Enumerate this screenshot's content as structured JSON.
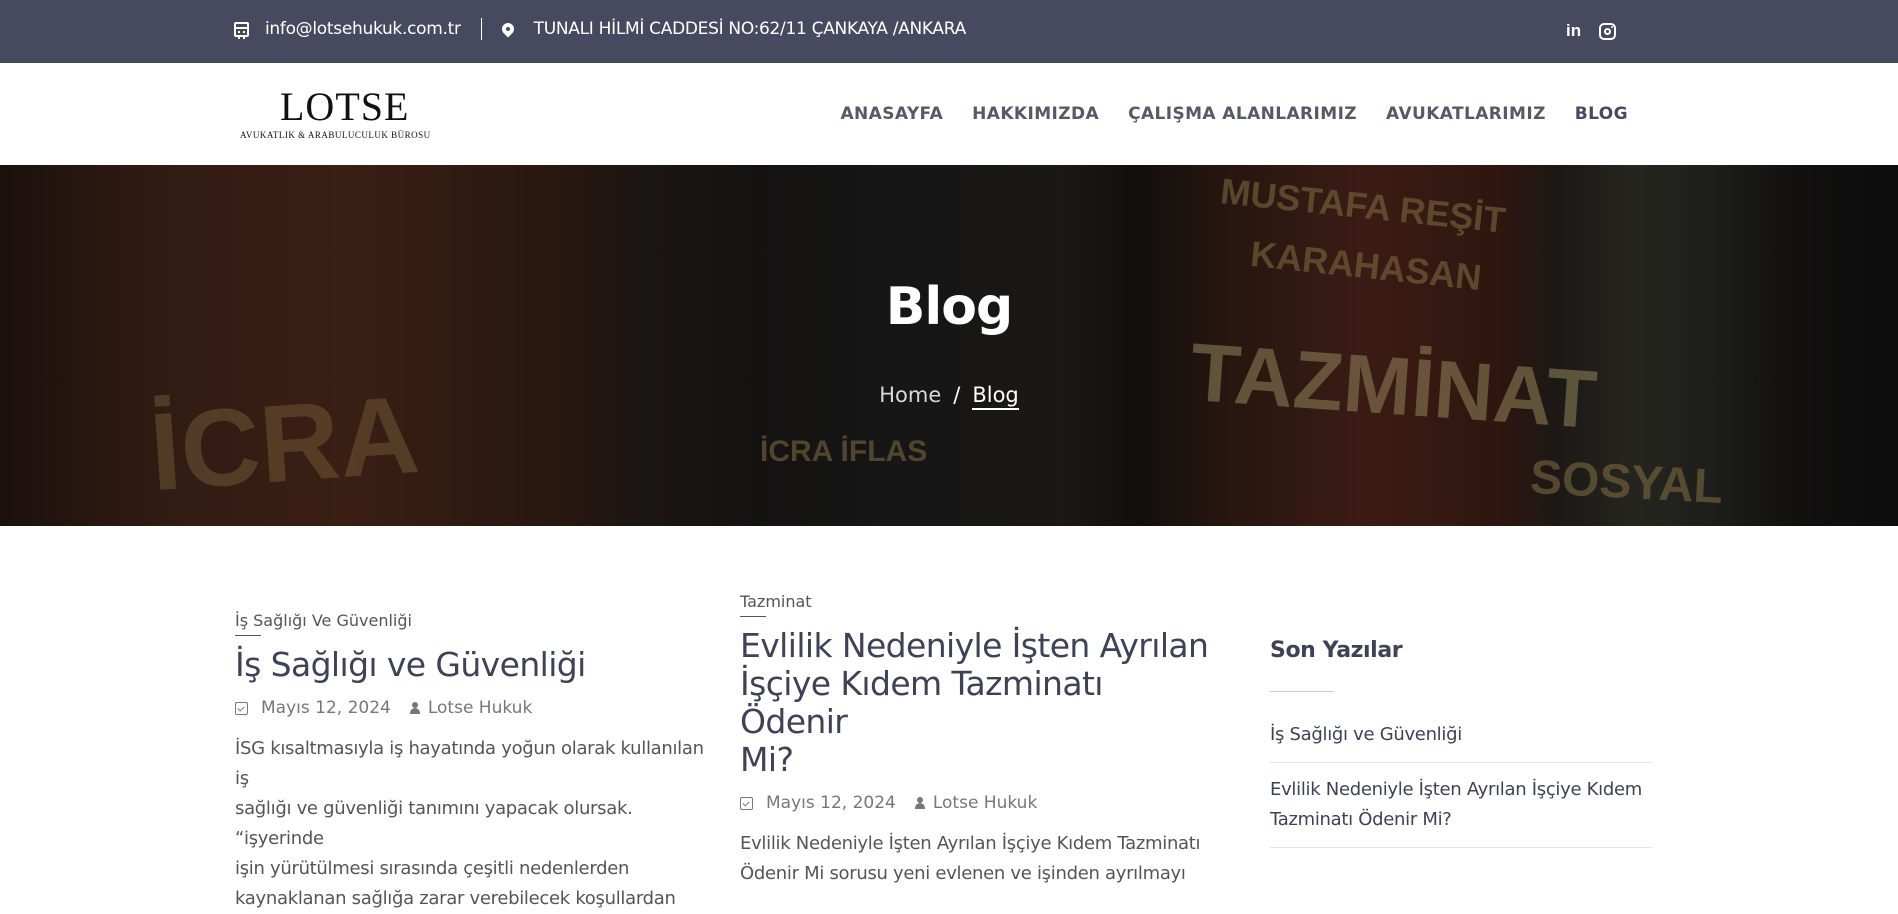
{
  "topbar": {
    "email": "info@lotsehukuk.com.tr",
    "address": "TUNALI HİLMİ CADDESİ NO:62/11 ÇANKAYA /ANKARA",
    "social": [
      "linkedin-icon",
      "instagram-icon"
    ]
  },
  "header": {
    "logo_text": "LOTSE",
    "logo_subtitle": "AVUKATLIK & ARABULUCULUK BÜROSU",
    "nav": [
      "ANASAYFA",
      "HAKKIMIZDA",
      "ÇALIŞMA ALANLARIMIZ",
      "AVUKATLARIMIZ",
      "BLOG"
    ],
    "active_nav": "BLOG"
  },
  "hero": {
    "title": "Blog",
    "breadcrumb_home": "Home",
    "breadcrumb_sep": "/",
    "breadcrumb_current": "Blog",
    "background_words": [
      "İCRA",
      "İCRA İFLAS",
      "MUSTAFA REŞİT",
      "KARAHASAN",
      "TAZMİNAT",
      "SOSYAL"
    ]
  },
  "posts": [
    {
      "category": "İş Sağlığı Ve Güvenliği",
      "title": "İş Sağlığı ve Güvenliği",
      "date": "Mayıs 12, 2024",
      "author": "Lotse Hukuk",
      "excerpt_lines": [
        "İSG kısaltmasıyla iş hayatında yoğun olarak kullanılan iş",
        "sağlığı ve güvenliği tanımını yapacak olursak. “işyerinde",
        "işin yürütülmesi sırasında çeşitli nedenlerden",
        "kaynaklanan sağlığa zarar verebilecek koşullardan"
      ]
    },
    {
      "category": "Tazminat",
      "title_lines": [
        "Evlilik Nedeniyle İşten Ayrılan",
        "İşçiye Kıdem Tazminatı Ödenir",
        "Mi?"
      ],
      "date": "Mayıs 12, 2024",
      "author": "Lotse Hukuk",
      "excerpt_lines": [
        "Evlilik Nedeniyle İşten Ayrılan İşçiye Kıdem Tazminatı",
        "Ödenir Mi sorusu yeni evlenen ve işinden ayrılmayı"
      ]
    }
  ],
  "sidebar": {
    "title": "Son Yazılar",
    "items": [
      "İş Sağlığı ve Güvenliği",
      "Evlilik Nedeniyle İşten Ayrılan İşçiye Kıdem Tazminatı Ödenir Mi?"
    ]
  },
  "colors": {
    "topbar_bg": "#474a5f",
    "heading": "#3e4256",
    "text": "#555555"
  }
}
